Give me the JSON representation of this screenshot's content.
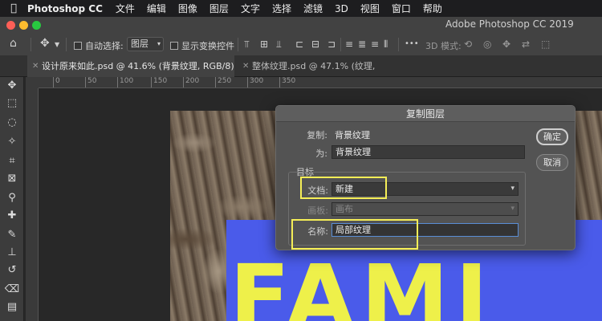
{
  "menubar": {
    "app_name": "Photoshop CC",
    "items": [
      "文件",
      "编辑",
      "图像",
      "图层",
      "文字",
      "选择",
      "滤镜",
      "3D",
      "视图",
      "窗口",
      "帮助"
    ]
  },
  "options_bar": {
    "window_title": "Adobe Photoshop CC 2019",
    "auto_select_label": "自动选择:",
    "auto_select_value": "图层",
    "show_transform_label": "显示变换控件",
    "more": "•••",
    "mode_3d": "3D 模式:"
  },
  "tabs": [
    {
      "label": "设计原来如此.psd @ 41.6% (背景纹理, RGB/8) *",
      "close": "✕"
    },
    {
      "label": "整体纹理.psd @ 47.1% (纹理, RGB/8)",
      "close": "✕"
    }
  ],
  "ruler": {
    "ticks": [
      "0",
      "50",
      "100",
      "150",
      "200",
      "250",
      "300",
      "350"
    ],
    "labels": [
      "0",
      "400",
      "600",
      "800"
    ]
  },
  "canvas": {
    "big_text": "FAMI"
  },
  "dialog": {
    "title": "复制图层",
    "copy_label": "复制:",
    "copy_value": "背景纹理",
    "as_label": "为:",
    "as_value": "背景纹理",
    "target_label": "目标",
    "document_label": "文档:",
    "document_value": "新建",
    "artboard_label": "画板:",
    "artboard_value": "画布",
    "name_label": "名称:",
    "name_value": "局部纹理",
    "ok_label": "确定",
    "cancel_label": "取消"
  },
  "colors": {
    "highlight": "#f5ee57",
    "canvas_blue": "#4a5bea",
    "big_text": "#eef04a"
  }
}
